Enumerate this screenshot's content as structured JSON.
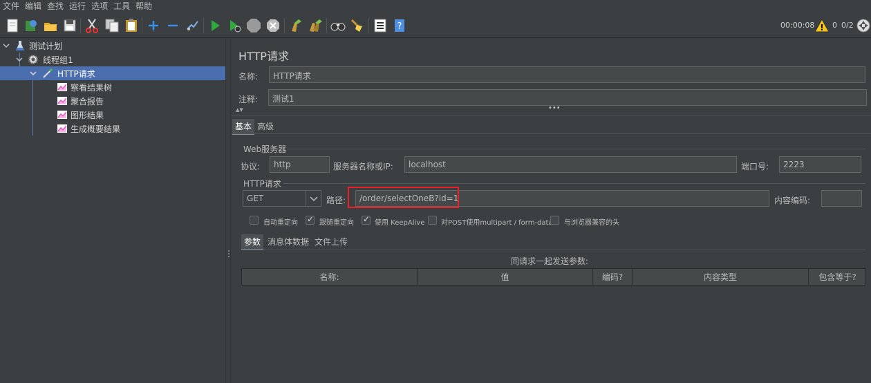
{
  "menu": [
    "文件",
    "编辑",
    "查找",
    "运行",
    "选项",
    "工具",
    "帮助"
  ],
  "toolbar": {
    "timer": "00:00:08",
    "warning_count": "0",
    "threads": "0/2"
  },
  "tree": {
    "items": [
      {
        "label": "测试计划",
        "icon": "test-plan-flask-icon"
      },
      {
        "label": "线程组1",
        "icon": "thread-group-gear-icon"
      },
      {
        "label": "HTTP请求",
        "icon": "sampler-pipette-icon"
      },
      {
        "label": "察看结果树",
        "icon": "listener-graph-icon"
      },
      {
        "label": "聚合报告",
        "icon": "listener-graph-icon"
      },
      {
        "label": "图形结果",
        "icon": "listener-graph-icon"
      },
      {
        "label": "生成概要结果",
        "icon": "listener-graph-icon"
      }
    ]
  },
  "panel": {
    "title": "HTTP请求",
    "name_label": "名称:",
    "name_value": "HTTP请求",
    "comment_label": "注释:",
    "comment_value": "测试1",
    "tabs": [
      "基本",
      "高级"
    ],
    "web_server": {
      "group_title": "Web服务器",
      "protocol_label": "协议:",
      "protocol_value": "http",
      "server_label": "服务器名称或IP:",
      "server_value": "localhost",
      "port_label": "端口号:",
      "port_value": "2223"
    },
    "http_request": {
      "group_title": "HTTP请求",
      "method": "GET",
      "path_label": "路径:",
      "path_value": "/order/selectOneB?id=1",
      "encoding_label": "内容编码:",
      "encoding_value": ""
    },
    "options": [
      {
        "label": "自动重定向",
        "checked": false
      },
      {
        "label": "跟随重定向",
        "checked": true
      },
      {
        "label": "使用 KeepAlive",
        "checked": true
      },
      {
        "label": "对POST使用multipart / form-data",
        "checked": false
      },
      {
        "label": "与浏览器兼容的头",
        "checked": false
      }
    ],
    "sub_tabs": [
      "参数",
      "消息体数据",
      "文件上传"
    ],
    "params_caption": "同请求一起发送参数:",
    "table_headers": [
      "名称:",
      "值",
      "编码?",
      "内容类型",
      "包含等于?"
    ]
  },
  "colors": {
    "background": "#3c3f41",
    "selection": "#4b6eaf",
    "highlight_box": "#e8212b"
  }
}
